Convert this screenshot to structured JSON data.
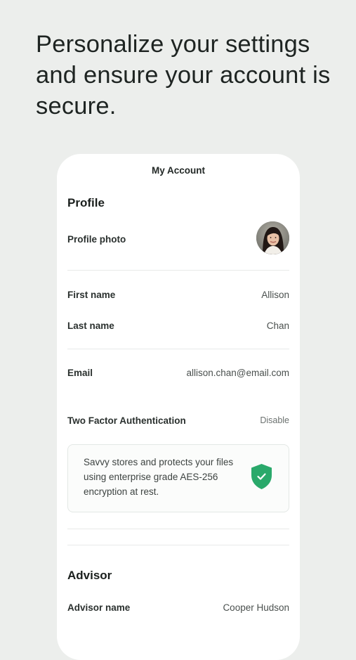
{
  "headline": "Personalize your settings and ensure your account is secure.",
  "screen": {
    "title": "My Account",
    "profile": {
      "section_title": "Profile",
      "photo_label": "Profile photo",
      "first_name_label": "First name",
      "first_name_value": "Allison",
      "last_name_label": "Last name",
      "last_name_value": "Chan",
      "email_label": "Email",
      "email_value": "allison.chan@email.com",
      "two_factor_label": "Two Factor Authentication",
      "two_factor_action": "Disable",
      "security_note": "Savvy stores and protects your files using enterprise grade AES-256 encryption at rest."
    },
    "advisor": {
      "section_title": "Advisor",
      "name_label": "Advisor name",
      "name_value": "Cooper Hudson"
    }
  },
  "colors": {
    "background": "#eceeec",
    "card": "#ffffff",
    "accent_green": "#2aa96b"
  },
  "icons": {
    "avatar": "user-photo",
    "security": "shield-check-icon"
  }
}
